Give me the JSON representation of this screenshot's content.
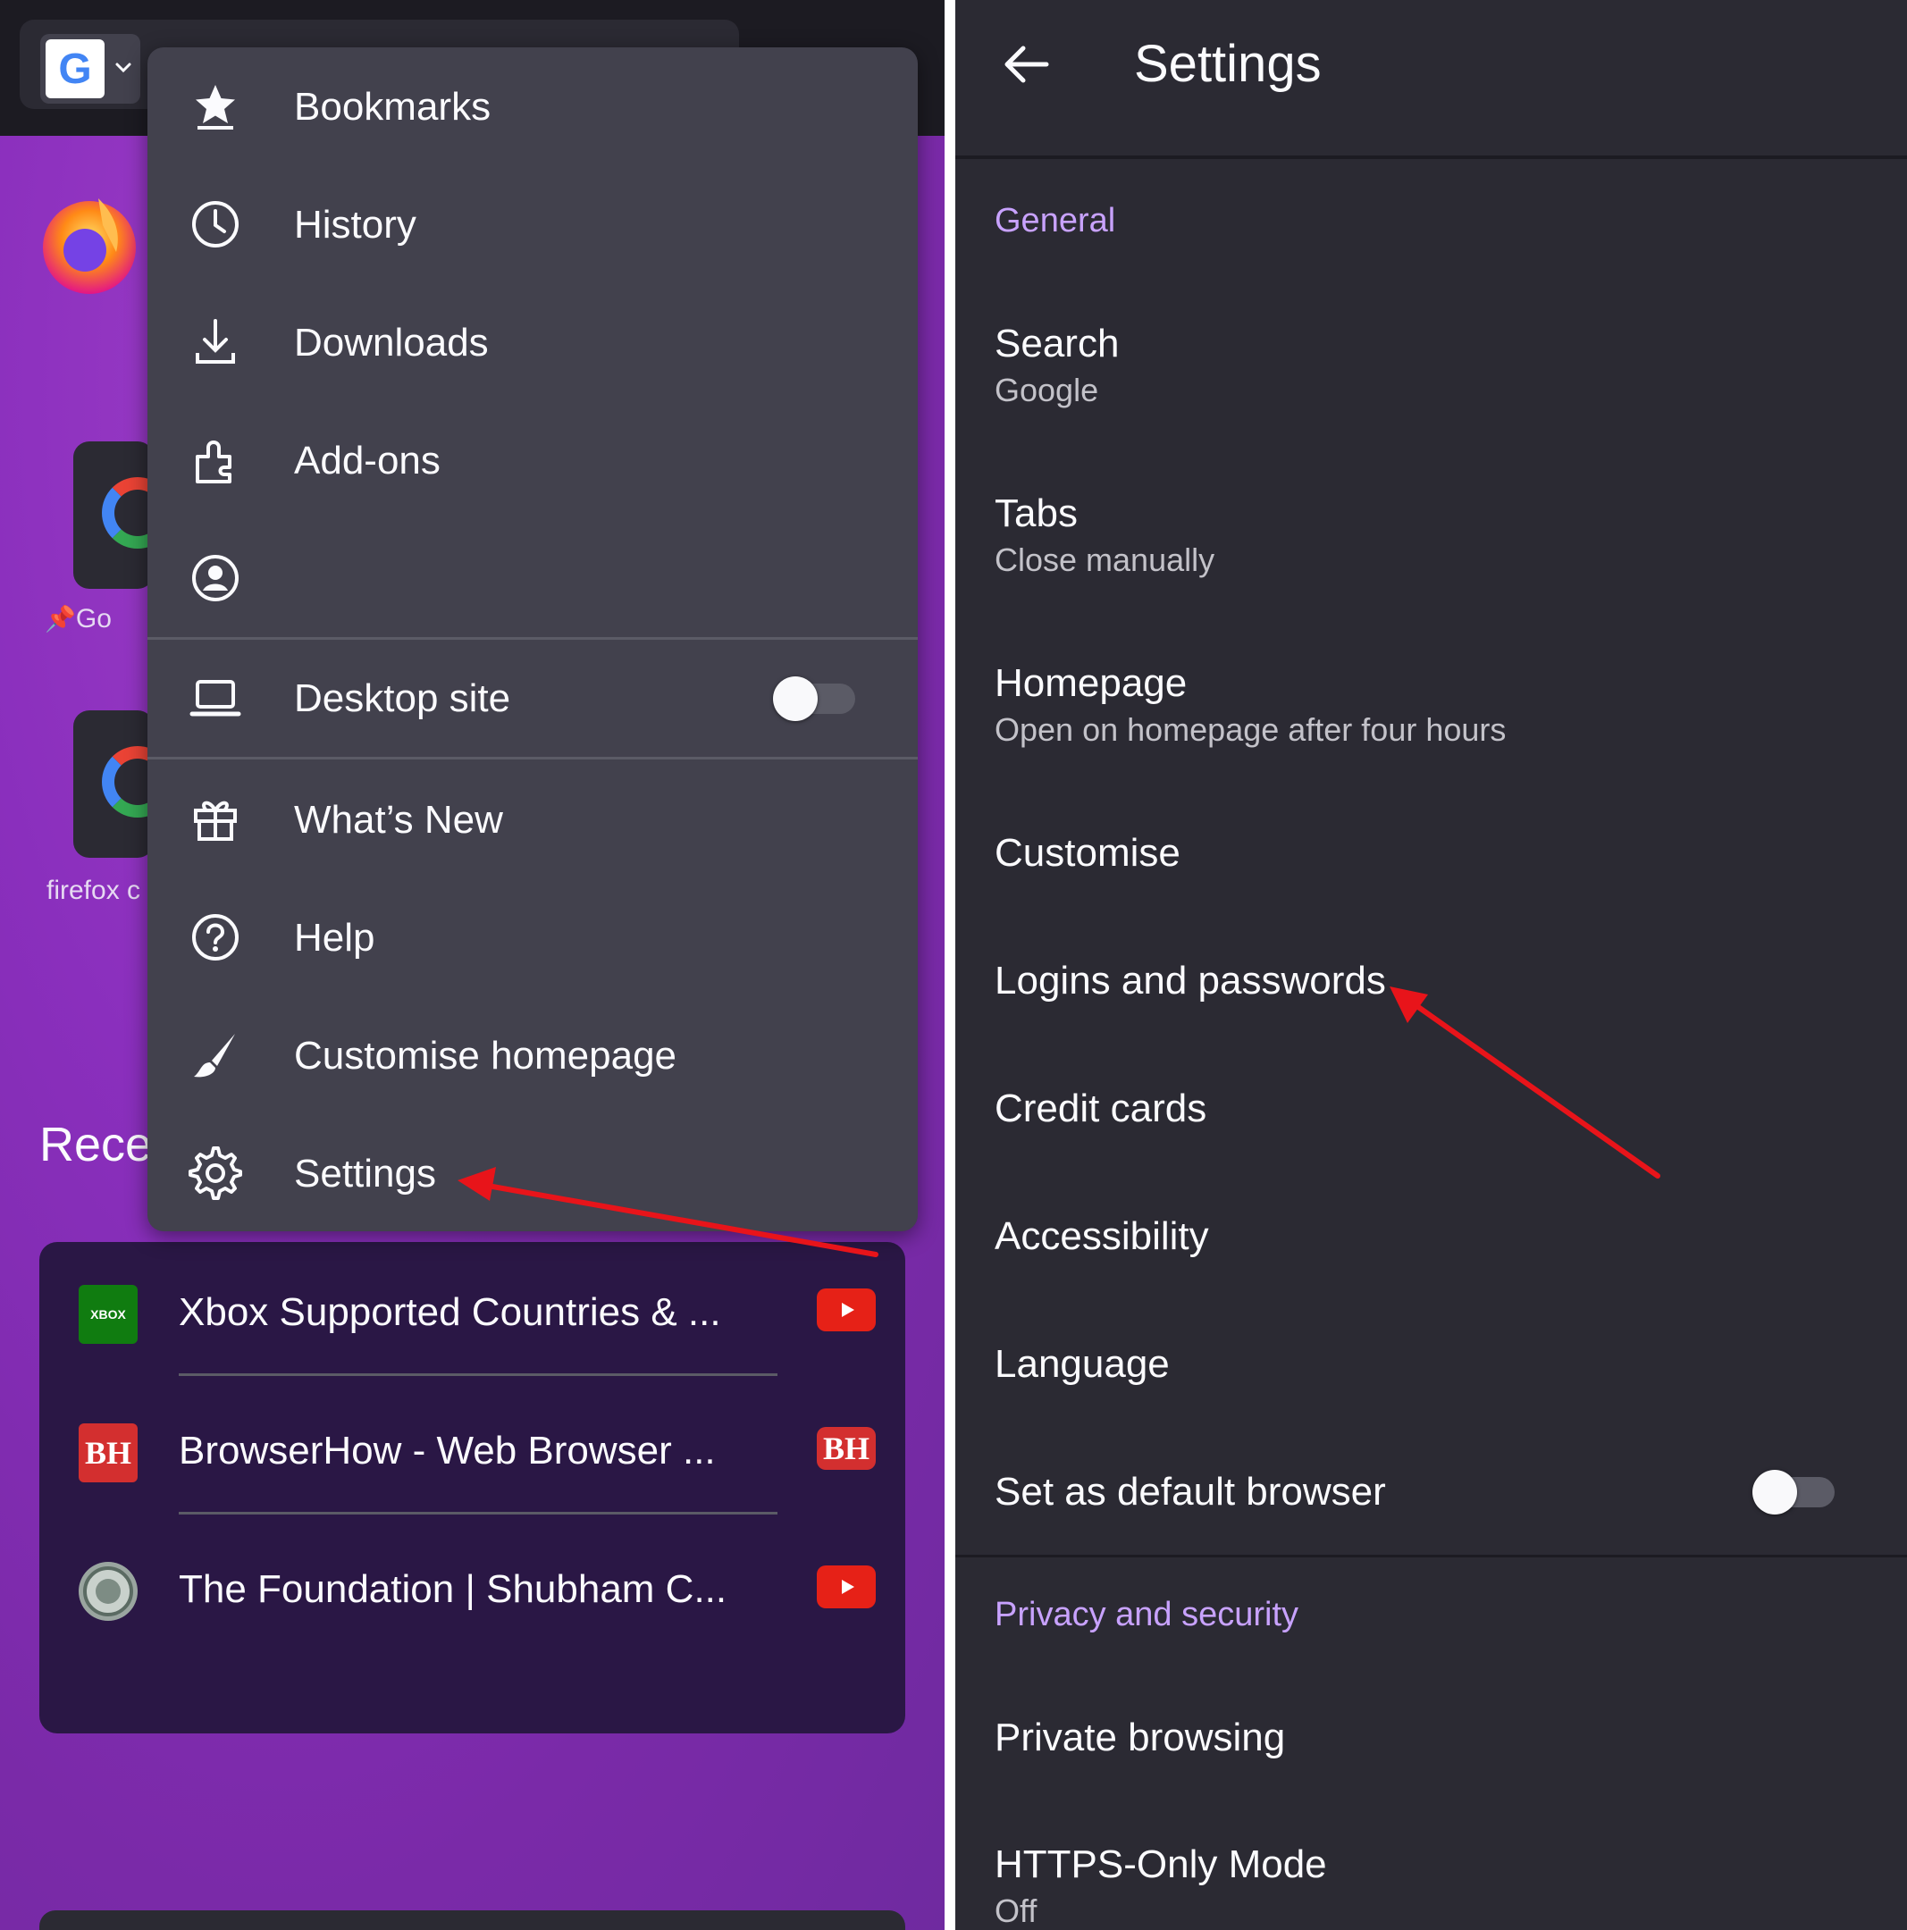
{
  "left_panel": {
    "engine_button": {
      "letter": "G"
    },
    "shortcuts": [
      {
        "label": "Go"
      },
      {
        "label": "firefox c"
      }
    ],
    "recent_heading": "Rece",
    "menu": {
      "items": [
        {
          "label": "Bookmarks",
          "icon": "star-icon"
        },
        {
          "label": "History",
          "icon": "clock-icon"
        },
        {
          "label": "Downloads",
          "icon": "download-icon"
        },
        {
          "label": "Add-ons",
          "icon": "puzzle-icon"
        },
        {
          "label": "",
          "icon": "account-icon"
        }
      ],
      "desktop_site": {
        "label": "Desktop site",
        "icon": "laptop-icon",
        "enabled": false
      },
      "bottom_items": [
        {
          "label": "What’s New",
          "icon": "gift-icon"
        },
        {
          "label": "Help",
          "icon": "help-icon"
        },
        {
          "label": "Customise homepage",
          "icon": "brush-icon"
        },
        {
          "label": "Settings",
          "icon": "gear-icon"
        }
      ]
    },
    "recent_tabs": [
      {
        "title": "Xbox Supported Countries & ...",
        "favicon_text": "XBOX",
        "source_icon": "youtube-icon"
      },
      {
        "title": "BrowserHow - Web Browser ...",
        "favicon_text": "BH",
        "source_icon": "bh-icon",
        "source_text": "BH"
      },
      {
        "title": "The Foundation | Shubham C...",
        "favicon_text": "",
        "source_icon": "youtube-icon"
      }
    ]
  },
  "right_panel": {
    "title": "Settings",
    "sections": {
      "general": "General",
      "privacy": "Privacy and security"
    },
    "items": {
      "search": {
        "title": "Search",
        "subtitle": "Google"
      },
      "tabs": {
        "title": "Tabs",
        "subtitle": "Close manually"
      },
      "homepage": {
        "title": "Homepage",
        "subtitle": "Open on homepage after four hours"
      },
      "customise": {
        "title": "Customise"
      },
      "logins": {
        "title": "Logins and passwords"
      },
      "credit_cards": {
        "title": "Credit cards"
      },
      "accessibility": {
        "title": "Accessibility"
      },
      "language": {
        "title": "Language"
      },
      "default_browser": {
        "title": "Set as default browser",
        "enabled": false
      },
      "private_browsing": {
        "title": "Private browsing"
      },
      "https_only": {
        "title": "HTTPS-Only Mode",
        "subtitle": "Off"
      }
    }
  },
  "colors": {
    "accent": "#c8a2ff",
    "annotation_arrow": "#e8141a",
    "menu_bg": "#42414d",
    "settings_bg": "#2b2a33"
  }
}
